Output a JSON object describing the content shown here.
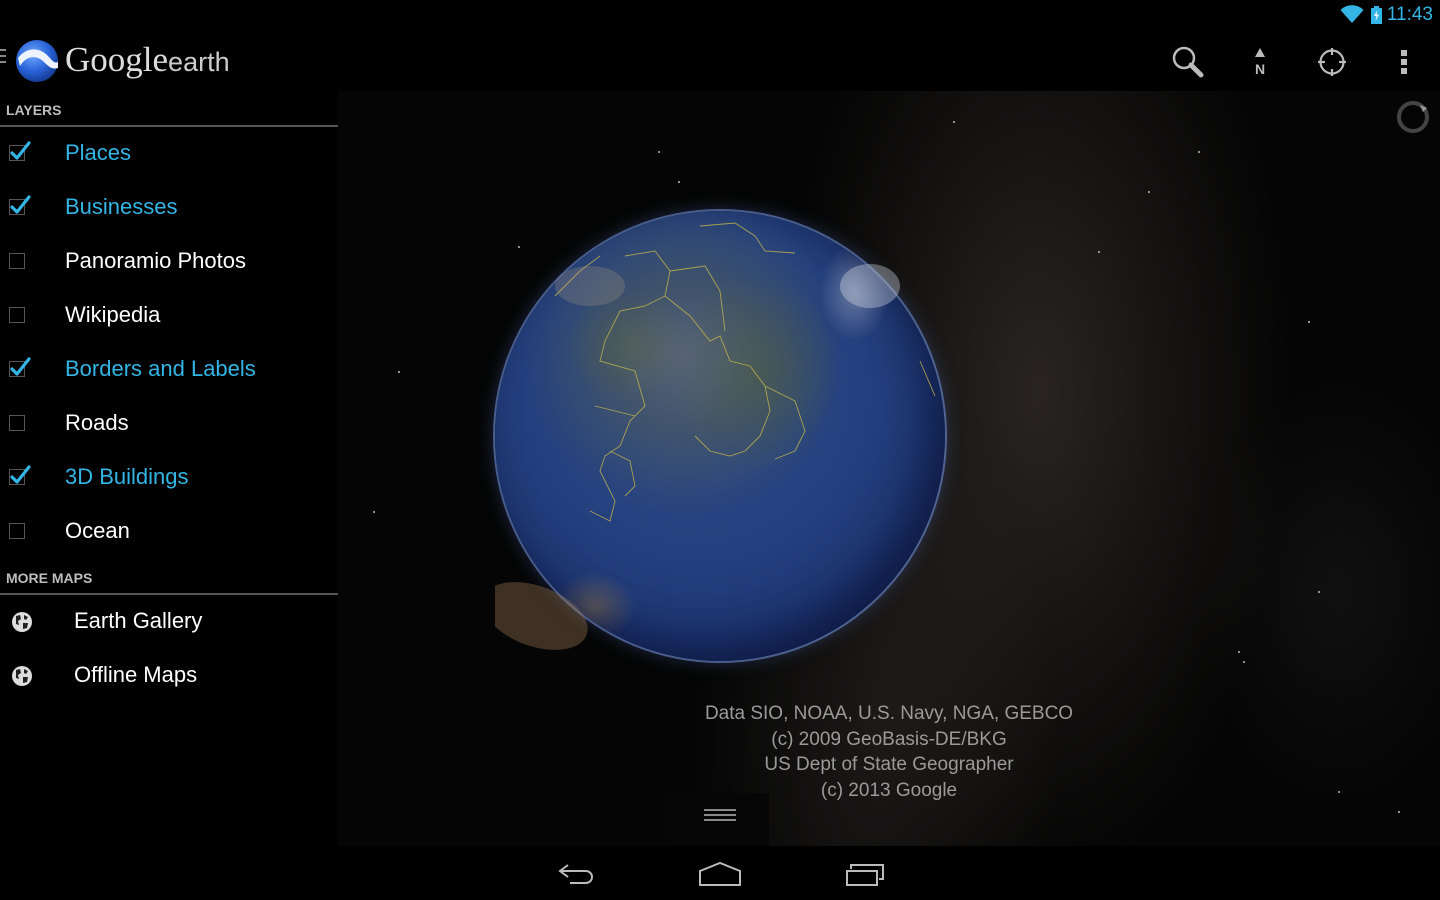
{
  "status_bar": {
    "time": "11:43",
    "wifi_icon": "wifi-icon",
    "battery_icon": "battery-charging-icon"
  },
  "action_bar": {
    "logo_icon": "google-earth-logo",
    "app_name_part1": "Google",
    "app_name_part2": "earth",
    "actions": [
      {
        "name": "search",
        "icon": "search-icon"
      },
      {
        "name": "north",
        "icon": "compass-north-icon",
        "label": "N"
      },
      {
        "name": "my-location",
        "icon": "crosshair-icon"
      },
      {
        "name": "overflow-menu",
        "icon": "more-vert-icon"
      }
    ]
  },
  "sidebar": {
    "layers_header": "LAYERS",
    "layers": [
      {
        "label": "Places",
        "checked": true
      },
      {
        "label": "Businesses",
        "checked": true
      },
      {
        "label": "Panoramio Photos",
        "checked": false
      },
      {
        "label": "Wikipedia",
        "checked": false
      },
      {
        "label": "Borders and Labels",
        "checked": true
      },
      {
        "label": "Roads",
        "checked": false
      },
      {
        "label": "3D Buildings",
        "checked": true
      },
      {
        "label": "Ocean",
        "checked": false
      }
    ],
    "more_maps_header": "MORE MAPS",
    "more_maps": [
      {
        "label": "Earth Gallery",
        "icon": "globe-icon"
      },
      {
        "label": "Offline Maps",
        "icon": "globe-icon"
      }
    ]
  },
  "map": {
    "attribution": [
      "Data SIO, NOAA, U.S. Navy, NGA, GEBCO",
      "(c) 2009 GeoBasis-DE/BKG",
      "US Dept of State Geographer",
      "(c) 2013 Google"
    ],
    "loading_indicator": "spinner-icon",
    "drawer_handle": "drag-handle-icon"
  },
  "nav_bar": {
    "buttons": [
      {
        "name": "back",
        "icon": "back-icon"
      },
      {
        "name": "home",
        "icon": "home-icon"
      },
      {
        "name": "recent-apps",
        "icon": "recents-icon"
      }
    ]
  },
  "colors": {
    "accent": "#33b5e5",
    "background": "#000000",
    "unchecked_text": "#ffffff",
    "header_text": "#bdbdbd"
  }
}
